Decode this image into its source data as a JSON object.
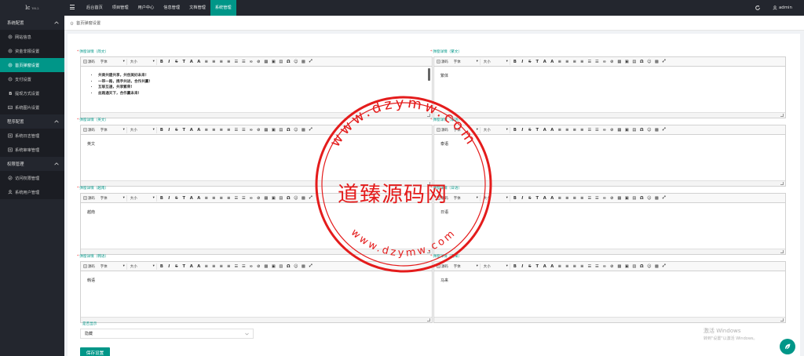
{
  "app": {
    "logo_text": "lc",
    "logo_version": "V6.2",
    "user": "admin"
  },
  "topnav": [
    {
      "label": "后台首页",
      "active": false
    },
    {
      "label": "项目管理",
      "active": false
    },
    {
      "label": "用户中心",
      "active": false
    },
    {
      "label": "信息管理",
      "active": false
    },
    {
      "label": "文档管理",
      "active": false
    },
    {
      "label": "系统管理",
      "active": true
    }
  ],
  "sidebar": {
    "groups": [
      {
        "label": "系统配置",
        "items": [
          {
            "label": "网站信息",
            "icon": "settings-icon",
            "active": false
          },
          {
            "label": "资金非报设置",
            "icon": "settings-icon",
            "active": false
          },
          {
            "label": "首页弹窗设置",
            "icon": "settings-icon",
            "active": true
          },
          {
            "label": "支付设置",
            "icon": "cycle-icon",
            "active": false
          },
          {
            "label": "提现方式设置",
            "icon": "bold-b-icon",
            "active": false
          },
          {
            "label": "系统图片设置",
            "icon": "image-icon",
            "active": false
          }
        ]
      },
      {
        "label": "程序配置",
        "items": [
          {
            "label": "系统日志管理",
            "icon": "list-icon",
            "active": false
          },
          {
            "label": "系统审审管理",
            "icon": "list-icon",
            "active": false
          }
        ]
      },
      {
        "label": "权限管理",
        "items": [
          {
            "label": "访问权限管理",
            "icon": "shield-icon",
            "active": false
          },
          {
            "label": "系统用户管理",
            "icon": "user-icon",
            "active": false
          }
        ]
      }
    ]
  },
  "breadcrumb": {
    "label": "首页弹窗设置"
  },
  "toolbar": {
    "source_label": "源码",
    "font_label": "字体",
    "size_label": "大小"
  },
  "editors": [
    {
      "label": "弹窗详情（简文）",
      "content_list": [
        "共商共建共享，共创美好未来!",
        "一带一路，携手共进，合作共赢!",
        "互联互通，共享繁荣!",
        "丝路通天下，合作赢未来!"
      ],
      "content": ""
    },
    {
      "label": "弹窗详情（繁文）",
      "content_list": [],
      "content": "繁体"
    },
    {
      "label": "弹窗详情（英文）",
      "content_list": [],
      "content": "英文"
    },
    {
      "label": "弹窗详情（泰语）",
      "content_list": [],
      "content": "泰语"
    },
    {
      "label": "弹窗详情（越南）",
      "content_list": [],
      "content": "越南"
    },
    {
      "label": "弹窗详情（日语）",
      "content_list": [],
      "content": "日语"
    },
    {
      "label": "弹窗详情（韩语）",
      "content_list": [],
      "content": "韩语"
    },
    {
      "label": "弹窗详情（马来）",
      "content_list": [],
      "content": "马来"
    }
  ],
  "popup_display": {
    "label": "是否显示",
    "value": "隐藏"
  },
  "save_label": "保存设置",
  "windows_watermark": {
    "line1": "激活 Windows",
    "line2": "转到\"设置\"以激活 Windows。"
  },
  "stamp": {
    "center_text": "道臻源码网",
    "ring_text_top": "www.dzymw.com",
    "ring_text_bottom": "www.dzymw.com",
    "color": "#e41c1c"
  },
  "accent_color": "#009688"
}
